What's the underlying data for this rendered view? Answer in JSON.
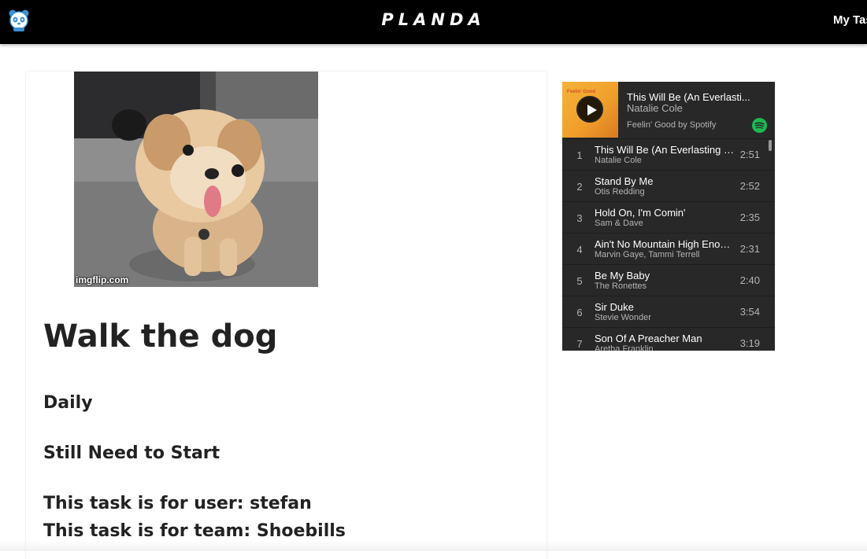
{
  "header": {
    "brand": "PLANDA",
    "nav_link": "My Tas"
  },
  "task": {
    "image_watermark": "imgflip.com",
    "title": "Walk the dog",
    "frequency": "Daily",
    "status": "Still Need to Start",
    "user_line": "This task is for user: stefan",
    "team_line": "This task is for team: Shoebills"
  },
  "spotify": {
    "now_playing_title": "This Will Be (An Everlasti...",
    "now_playing_artist": "Natalie Cole",
    "playlist": "Feelin' Good by Spotify",
    "cover_text": "Feelin' Good",
    "tracks": [
      {
        "num": "1",
        "title": "This Will Be (An Everlasting Lo...",
        "artist": "Natalie Cole",
        "duration": "2:51"
      },
      {
        "num": "2",
        "title": "Stand By Me",
        "artist": "Otis Redding",
        "duration": "2:52"
      },
      {
        "num": "3",
        "title": "Hold On, I'm Comin'",
        "artist": "Sam & Dave",
        "duration": "2:35"
      },
      {
        "num": "4",
        "title": "Ain't No Mountain High Enough",
        "artist": "Marvin Gaye, Tammi Terrell",
        "duration": "2:31"
      },
      {
        "num": "5",
        "title": "Be My Baby",
        "artist": "The Ronettes",
        "duration": "2:40"
      },
      {
        "num": "6",
        "title": "Sir Duke",
        "artist": "Stevie Wonder",
        "duration": "3:54"
      },
      {
        "num": "7",
        "title": "Son Of A Preacher Man",
        "artist": "Aretha Franklin",
        "duration": "3:19"
      }
    ],
    "accent_color": "#1db954"
  },
  "colors": {
    "header_bg": "#000000",
    "widget_bg": "#282828"
  }
}
